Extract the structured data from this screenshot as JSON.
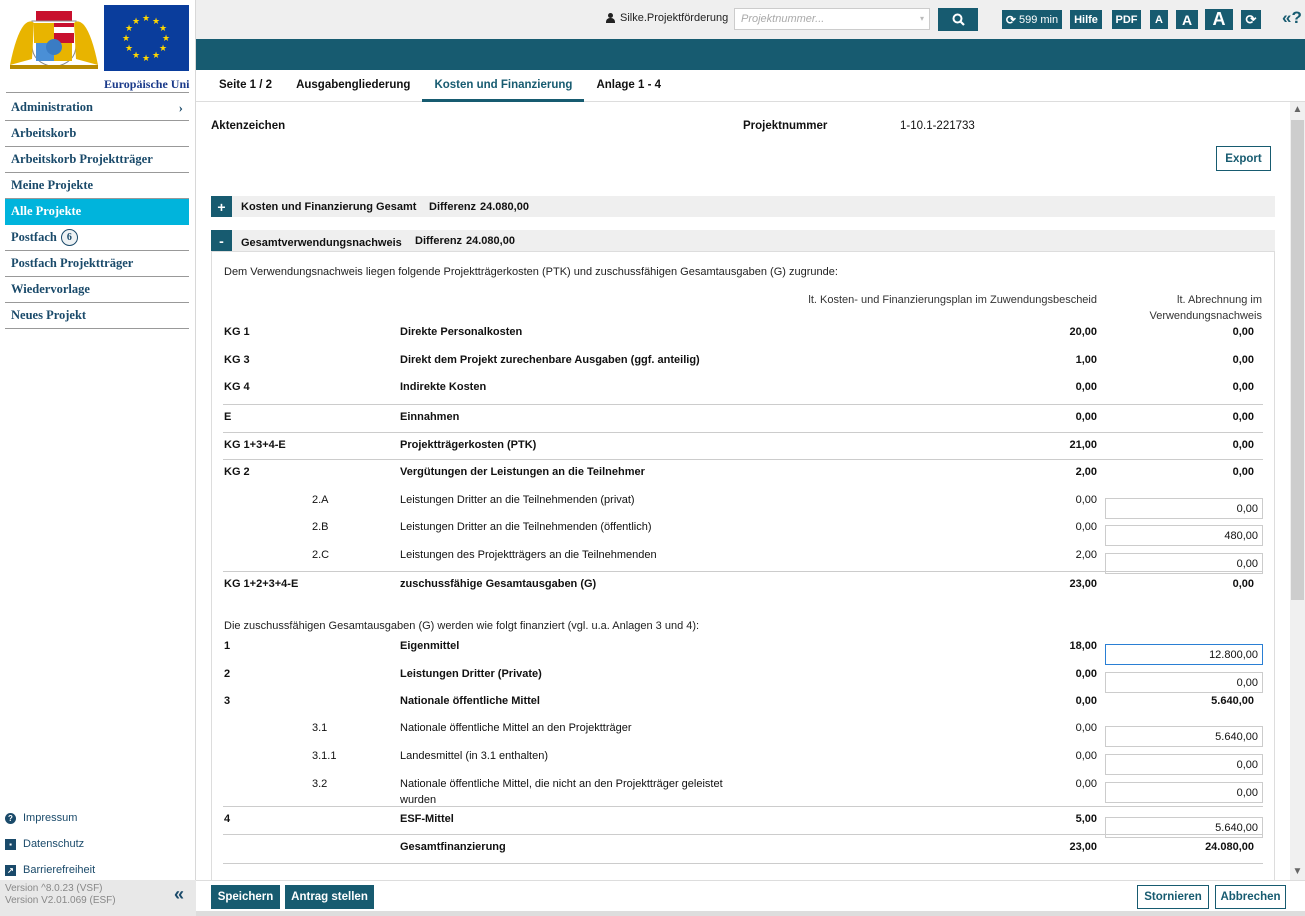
{
  "sidebar": {
    "logo_text": "Europäische Union",
    "nav": [
      {
        "label": "Administration",
        "has_chevron": true
      },
      {
        "label": "Arbeitskorb"
      },
      {
        "label": "Arbeitskorb Projektträger"
      },
      {
        "label": "Meine Projekte"
      },
      {
        "label": "Alle Projekte",
        "active": true
      },
      {
        "label": "Postfach",
        "badge": "6"
      },
      {
        "label": "Postfach Projektträger"
      },
      {
        "label": "Wiedervorlage"
      },
      {
        "label": "Neues Projekt"
      }
    ],
    "footer_links": [
      {
        "label": "Impressum",
        "icon": "question-circle-icon"
      },
      {
        "label": "Datenschutz",
        "icon": "id-card-icon"
      },
      {
        "label": "Barrierefreiheit",
        "icon": "external-link-icon"
      }
    ],
    "version_lines": [
      "Version ^8.0.23 (VSF)",
      "Version V2.01.069 (ESF)"
    ],
    "collapse_symbol": "«"
  },
  "topbar": {
    "user_name": "Silke.Projektförderung",
    "search_placeholder": "Projektnummer...",
    "session_timer": "599 min",
    "help_label": "Hilfe",
    "pdf_label": "PDF",
    "font_small": "A",
    "font_medium": "A",
    "font_large": "A",
    "help_icon_text": "«?"
  },
  "tabs": [
    {
      "label": "Seite 1 / 2"
    },
    {
      "label": "Ausgabengliederung"
    },
    {
      "label": "Kosten und Finanzierung",
      "active": true
    },
    {
      "label": "Anlage 1 - 4"
    }
  ],
  "meta": {
    "aktenzeichen_label": "Aktenzeichen",
    "aktenzeichen_value": "",
    "projektnummer_label": "Projektnummer",
    "projektnummer_value": "1-10.1-221733",
    "export_label": "Export"
  },
  "panels": [
    {
      "toggle": "+",
      "title": "Kosten und Finanzierung Gesamt",
      "diff_label": "Differenz",
      "diff_value": "24.080,00"
    },
    {
      "toggle": "-",
      "title": "Gesamtverwendungsnachweis",
      "diff_label": "Differenz",
      "diff_value": "24.080,00"
    }
  ],
  "table": {
    "intro": "Dem Verwendungsnachweis liegen folgende Projektträgerkosten (PTK) und zuschussfähigen Gesamtausgaben (G) zugrunde:",
    "col_plan": "lt. Kosten- und Finanzierungsplan im Zuwendungsbescheid",
    "col_actual_1": "lt. Abrechnung im",
    "col_actual_2": "Verwendungsnachweis",
    "cost_rows": [
      {
        "code": "KG 1",
        "sub": "",
        "label": "Direkte Personalkosten",
        "plan": "20,00",
        "actual": "0,00",
        "bold": true,
        "input": false
      },
      {
        "code": "KG 3",
        "sub": "",
        "label": "Direkt dem Projekt zurechenbare Ausgaben (ggf. anteilig)",
        "plan": "1,00",
        "actual": "0,00",
        "bold": true,
        "input": false
      },
      {
        "code": "KG 4",
        "sub": "",
        "label": "Indirekte Kosten",
        "plan": "0,00",
        "actual": "0,00",
        "bold": true,
        "input": false
      },
      {
        "code": "E",
        "sub": "",
        "label": "Einnahmen",
        "plan": "0,00",
        "actual": "0,00",
        "bold": true,
        "input": false
      },
      {
        "code": "KG 1+3+4-E",
        "sub": "",
        "label": "Projektträgerkosten (PTK)",
        "plan": "21,00",
        "actual": "0,00",
        "bold": true,
        "input": false
      },
      {
        "code": "KG 2",
        "sub": "",
        "label": "Vergütungen der Leistungen an die Teilnehmer",
        "plan": "2,00",
        "actual": "0,00",
        "bold": true,
        "input": false
      },
      {
        "code": "",
        "sub": "2.A",
        "label": "Leistungen Dritter an die Teilnehmenden (privat)",
        "plan": "0,00",
        "actual": "0,00",
        "bold": false,
        "input": true
      },
      {
        "code": "",
        "sub": "2.B",
        "label": "Leistungen Dritter an die Teilnehmenden (öffentlich)",
        "plan": "0,00",
        "actual": "480,00",
        "bold": false,
        "input": true
      },
      {
        "code": "",
        "sub": "2.C",
        "label": "Leistungen des Projektträgers an die Teilnehmenden",
        "plan": "2,00",
        "actual": "0,00",
        "bold": false,
        "input": true
      },
      {
        "code": "KG 1+2+3+4-E",
        "sub": "",
        "label": "zuschussfähige Gesamtausgaben (G)",
        "plan": "23,00",
        "actual": "0,00",
        "bold": true,
        "input": false
      }
    ],
    "financing_intro": "Die zuschussfähigen Gesamtausgaben (G) werden wie folgt finanziert (vgl. u.a. Anlagen 3 und 4):",
    "financing_rows": [
      {
        "code": "1",
        "sub": "",
        "label": "Eigenmittel",
        "plan": "18,00",
        "actual": "12.800,00",
        "bold": true,
        "input": true,
        "focused": true
      },
      {
        "code": "2",
        "sub": "",
        "label": "Leistungen Dritter (Private)",
        "plan": "0,00",
        "actual": "0,00",
        "bold": true,
        "input": true
      },
      {
        "code": "3",
        "sub": "",
        "label": "Nationale öffentliche Mittel",
        "plan": "0,00",
        "actual": "5.640,00",
        "bold": true,
        "input": false
      },
      {
        "code": "",
        "sub": "3.1",
        "label": "Nationale öffentliche Mittel an den Projektträger",
        "plan": "0,00",
        "actual": "5.640,00",
        "bold": false,
        "input": true
      },
      {
        "code": "",
        "sub": "3.1.1",
        "label": "Landesmittel (in 3.1 enthalten)",
        "plan": "0,00",
        "actual": "0,00",
        "bold": false,
        "input": true
      },
      {
        "code": "",
        "sub": "3.2",
        "label": "Nationale öffentliche Mittel, die nicht an den Projektträger geleistet wurden",
        "plan": "0,00",
        "actual": "0,00",
        "bold": false,
        "input": true
      },
      {
        "code": "4",
        "sub": "",
        "label": "ESF-Mittel",
        "plan": "5,00",
        "actual": "5.640,00",
        "bold": true,
        "input": true
      },
      {
        "code": "",
        "sub": "",
        "label": "Gesamtfinanzierung",
        "plan": "23,00",
        "actual": "24.080,00",
        "bold": true,
        "input": false
      }
    ]
  },
  "actions": {
    "save": "Speichern",
    "submit": "Antrag stellen",
    "cancel_request": "Stornieren",
    "abort": "Abbrechen"
  },
  "colors": {
    "primary": "#175b70",
    "active_nav": "#00b4dc",
    "focus": "#2a7fd4"
  }
}
